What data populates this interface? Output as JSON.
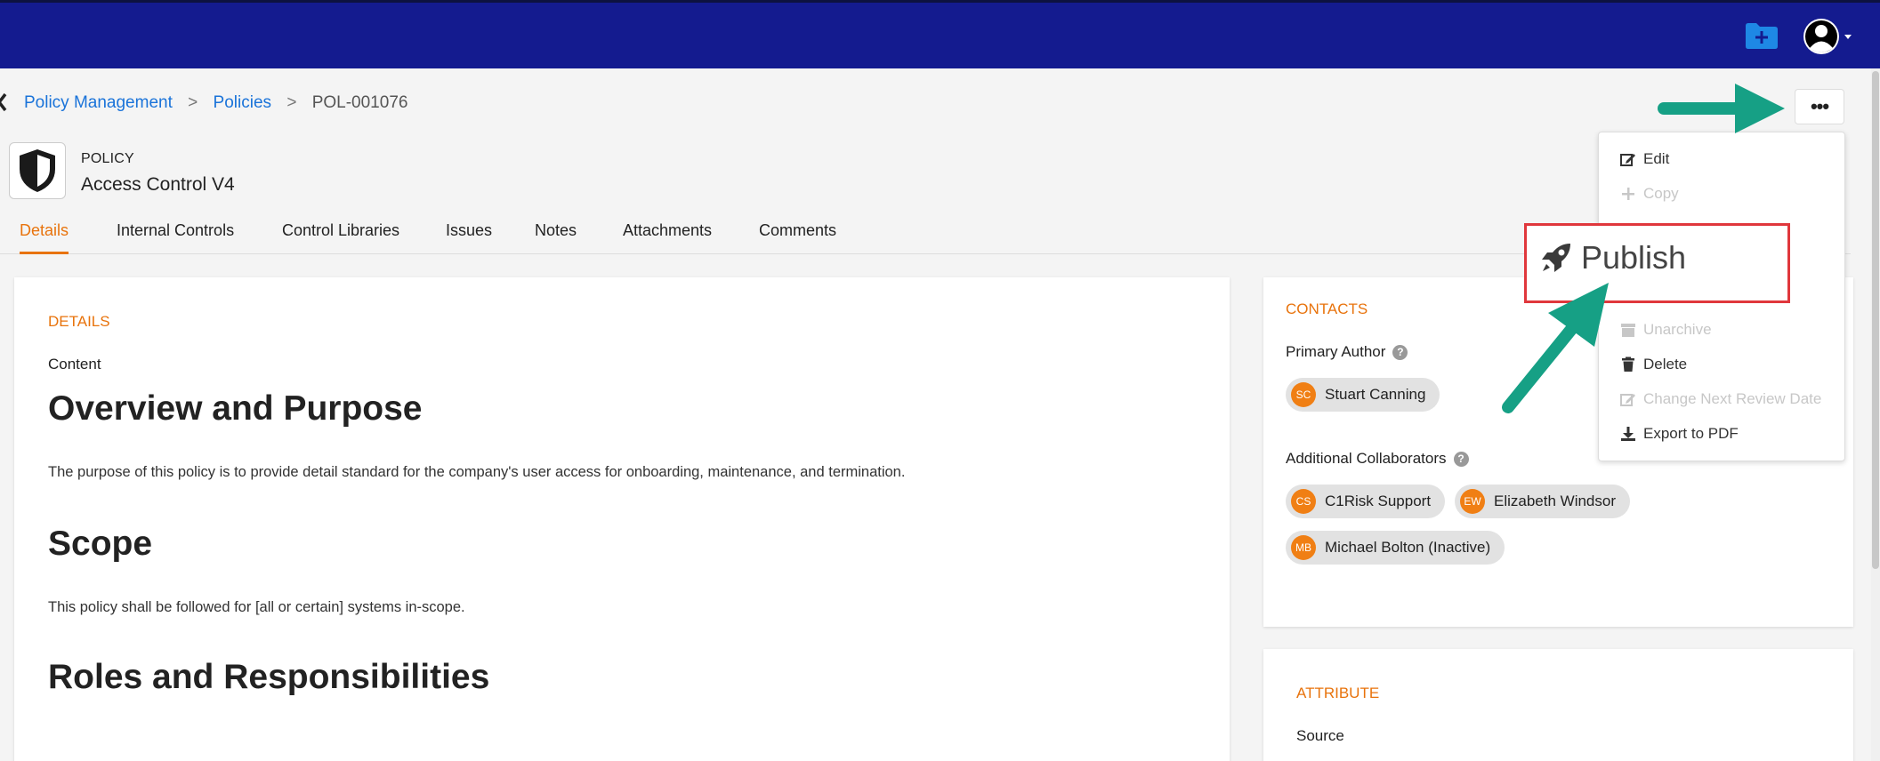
{
  "topbar": {
    "bg_color": "#141b8f",
    "folder_icon": "folder-plus-icon",
    "avatar_icon": "user-avatar-icon"
  },
  "breadcrumb": {
    "items": [
      "Policy Management",
      "Policies",
      "POL-001076"
    ],
    "separator": ">"
  },
  "policy": {
    "type_label": "POLICY",
    "title": "Access Control V4",
    "icon": "shield-icon"
  },
  "tabs": [
    "Details",
    "Internal Controls",
    "Control Libraries",
    "Issues",
    "Notes",
    "Attachments",
    "Comments"
  ],
  "details": {
    "section_label": "DETAILS",
    "content_label": "Content",
    "heading1": "Overview and Purpose",
    "para1": "The purpose of this policy is to provide detail standard for the company's user access for onboarding, maintenance, and termination.",
    "heading2": "Scope",
    "para2": "This policy shall be followed for [all or certain] systems in-scope.",
    "heading3": "Roles and Responsibilities"
  },
  "contacts": {
    "section_label": "CONTACTS",
    "primary_author_label": "Primary Author",
    "primary_author": {
      "initials": "SC",
      "name": "Stuart Canning"
    },
    "collaborators_label": "Additional Collaborators",
    "collaborators": [
      {
        "initials": "CS",
        "name": "C1Risk Support"
      },
      {
        "initials": "EW",
        "name": "Elizabeth Windsor"
      },
      {
        "initials": "MB",
        "name": "Michael Bolton (Inactive)"
      }
    ]
  },
  "attribute": {
    "section_label": "ATTRIBUTE",
    "source_label": "Source"
  },
  "actions_menu": {
    "more_label": "•••",
    "items": {
      "edit": "Edit",
      "copy": "Copy",
      "unarchive": "Unarchive",
      "delete": "Delete",
      "change_review": "Change Next Review Date",
      "export_pdf": "Export to PDF"
    }
  },
  "callout": {
    "label": "Publish",
    "icon": "rocket-icon",
    "border_color": "#e0373c"
  },
  "arrow_color": "#16a085",
  "accent_color": "#e8730c",
  "link_color": "#1a73d9"
}
